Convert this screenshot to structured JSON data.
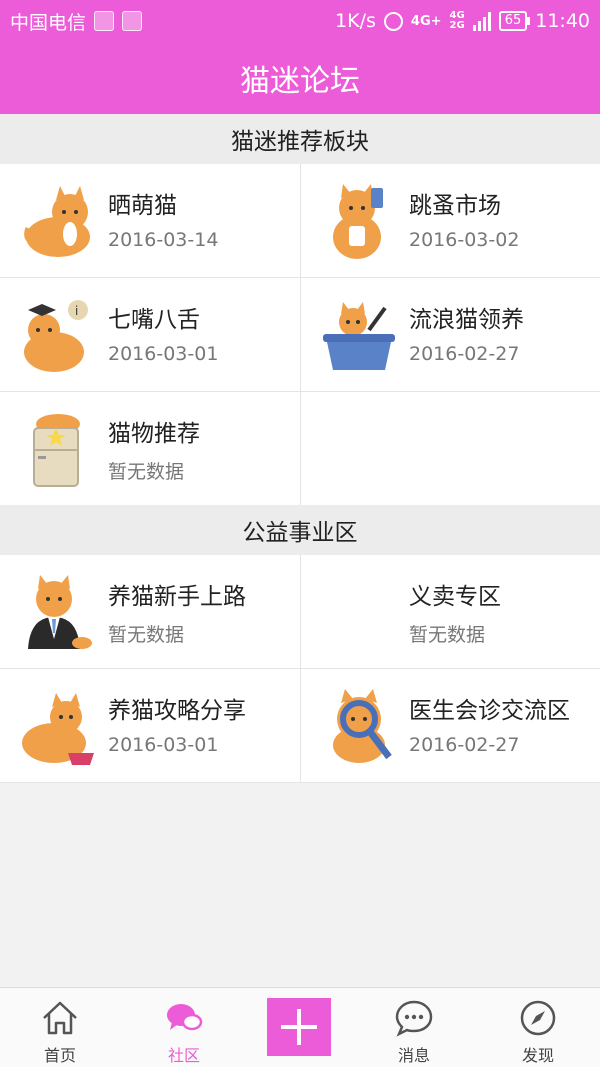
{
  "status_bar": {
    "carrier": "中国电信",
    "speed": "1K/s",
    "network": "4G+",
    "network2": "4G",
    "network3": "2G",
    "battery": "65",
    "time": "11:40"
  },
  "app": {
    "title": "猫迷论坛",
    "accent_color": "#ec5cd8"
  },
  "sections": [
    {
      "title": "猫迷推荐板块",
      "boards": [
        {
          "name": "晒萌猫",
          "date": "2016-03-14",
          "icon": "orange-cat-icon"
        },
        {
          "name": "跳蚤市场",
          "date": "2016-03-02",
          "icon": "cat-with-phone-icon"
        },
        {
          "name": "七嘴八舌",
          "date": "2016-03-01",
          "icon": "graduate-cat-icon"
        },
        {
          "name": "流浪猫领养",
          "date": "2016-02-27",
          "icon": "cat-in-basket-icon"
        },
        {
          "name": "猫物推荐",
          "date": "暂无数据",
          "icon": "cat-on-fridge-icon"
        }
      ]
    },
    {
      "title": "公益事业区",
      "boards": [
        {
          "name": "养猫新手上路",
          "date": "暂无数据",
          "icon": "suit-cat-icon"
        },
        {
          "name": "义卖专区",
          "date": "暂无数据",
          "icon": ""
        },
        {
          "name": "养猫攻略分享",
          "date": "2016-03-01",
          "icon": "cat-with-bowl-icon"
        },
        {
          "name": "医生会诊交流区",
          "date": "2016-02-27",
          "icon": "cat-with-magnifier-icon"
        }
      ]
    }
  ],
  "tab_bar": {
    "tabs": [
      {
        "label": "首页",
        "icon": "home-icon",
        "active": false
      },
      {
        "label": "社区",
        "icon": "chat-bubbles-icon",
        "active": true
      },
      {
        "label": "",
        "icon": "plus-icon",
        "active": false
      },
      {
        "label": "消息",
        "icon": "message-icon",
        "active": false
      },
      {
        "label": "发现",
        "icon": "compass-icon",
        "active": false
      }
    ]
  }
}
